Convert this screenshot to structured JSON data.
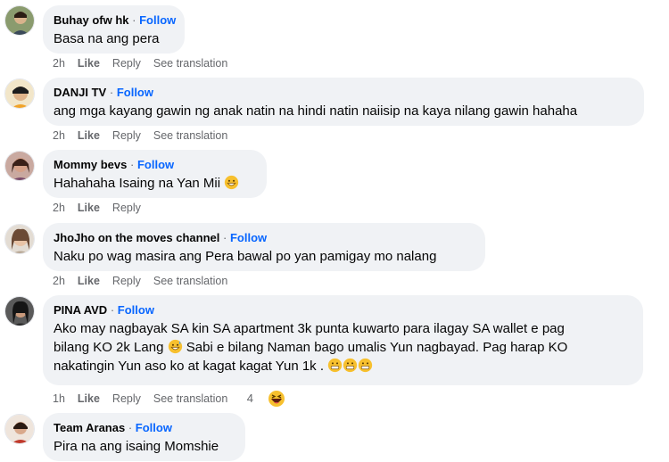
{
  "comments": [
    {
      "author": "Buhay ofw hk",
      "follow": "Follow",
      "lines": [
        "Basa na ang pera"
      ],
      "time": "2h",
      "like": "Like",
      "reply": "Reply",
      "see_translation": "See translation"
    },
    {
      "author": "DANJI TV",
      "follow": "Follow",
      "lines": [
        "ang mga kayang gawin ng anak natin na hindi natin naiisip na kaya nilang gawin hahaha"
      ],
      "time": "2h",
      "like": "Like",
      "reply": "Reply",
      "see_translation": "See translation"
    },
    {
      "author": "Mommy bevs",
      "follow": "Follow",
      "lines": [
        "Hahahaha Isaing na Yan Mii"
      ],
      "time": "2h",
      "like": "Like",
      "reply": "Reply"
    },
    {
      "author": "JhoJho on the moves channel",
      "follow": "Follow",
      "lines": [
        "Naku po wag masira ang Pera bawal po yan pamigay mo nalang"
      ],
      "time": "2h",
      "like": "Like",
      "reply": "Reply",
      "see_translation": "See translation"
    },
    {
      "author": "PINA AVD",
      "follow": "Follow",
      "lines": [
        "Ako may nagbayak SA kin SA apartment 3k punta kuwarto para ilagay SA wallet e pag",
        "bilang KO 2k Lang",
        "Sabi e bilang Naman bago umalis Yun nagbayad. Pag harap KO",
        "nakatingin Yun aso ko at kagat kagat Yun 1k ."
      ],
      "time": "1h",
      "like": "Like",
      "reply": "Reply",
      "see_translation": "See translation",
      "reaction_count": "4"
    },
    {
      "author": "Team Aranas",
      "follow": "Follow",
      "lines": [
        "Pira na ang isaing Momshie"
      ]
    }
  ],
  "icons": {
    "grin_sweat": "grinning-face-with-sweat-icon",
    "grimace": "grimacing-face-icon",
    "laugh": "laughing-face-icon"
  },
  "colors": {
    "follow": "#0866ff",
    "bubble": "#f0f2f5",
    "meta": "#65676b"
  }
}
